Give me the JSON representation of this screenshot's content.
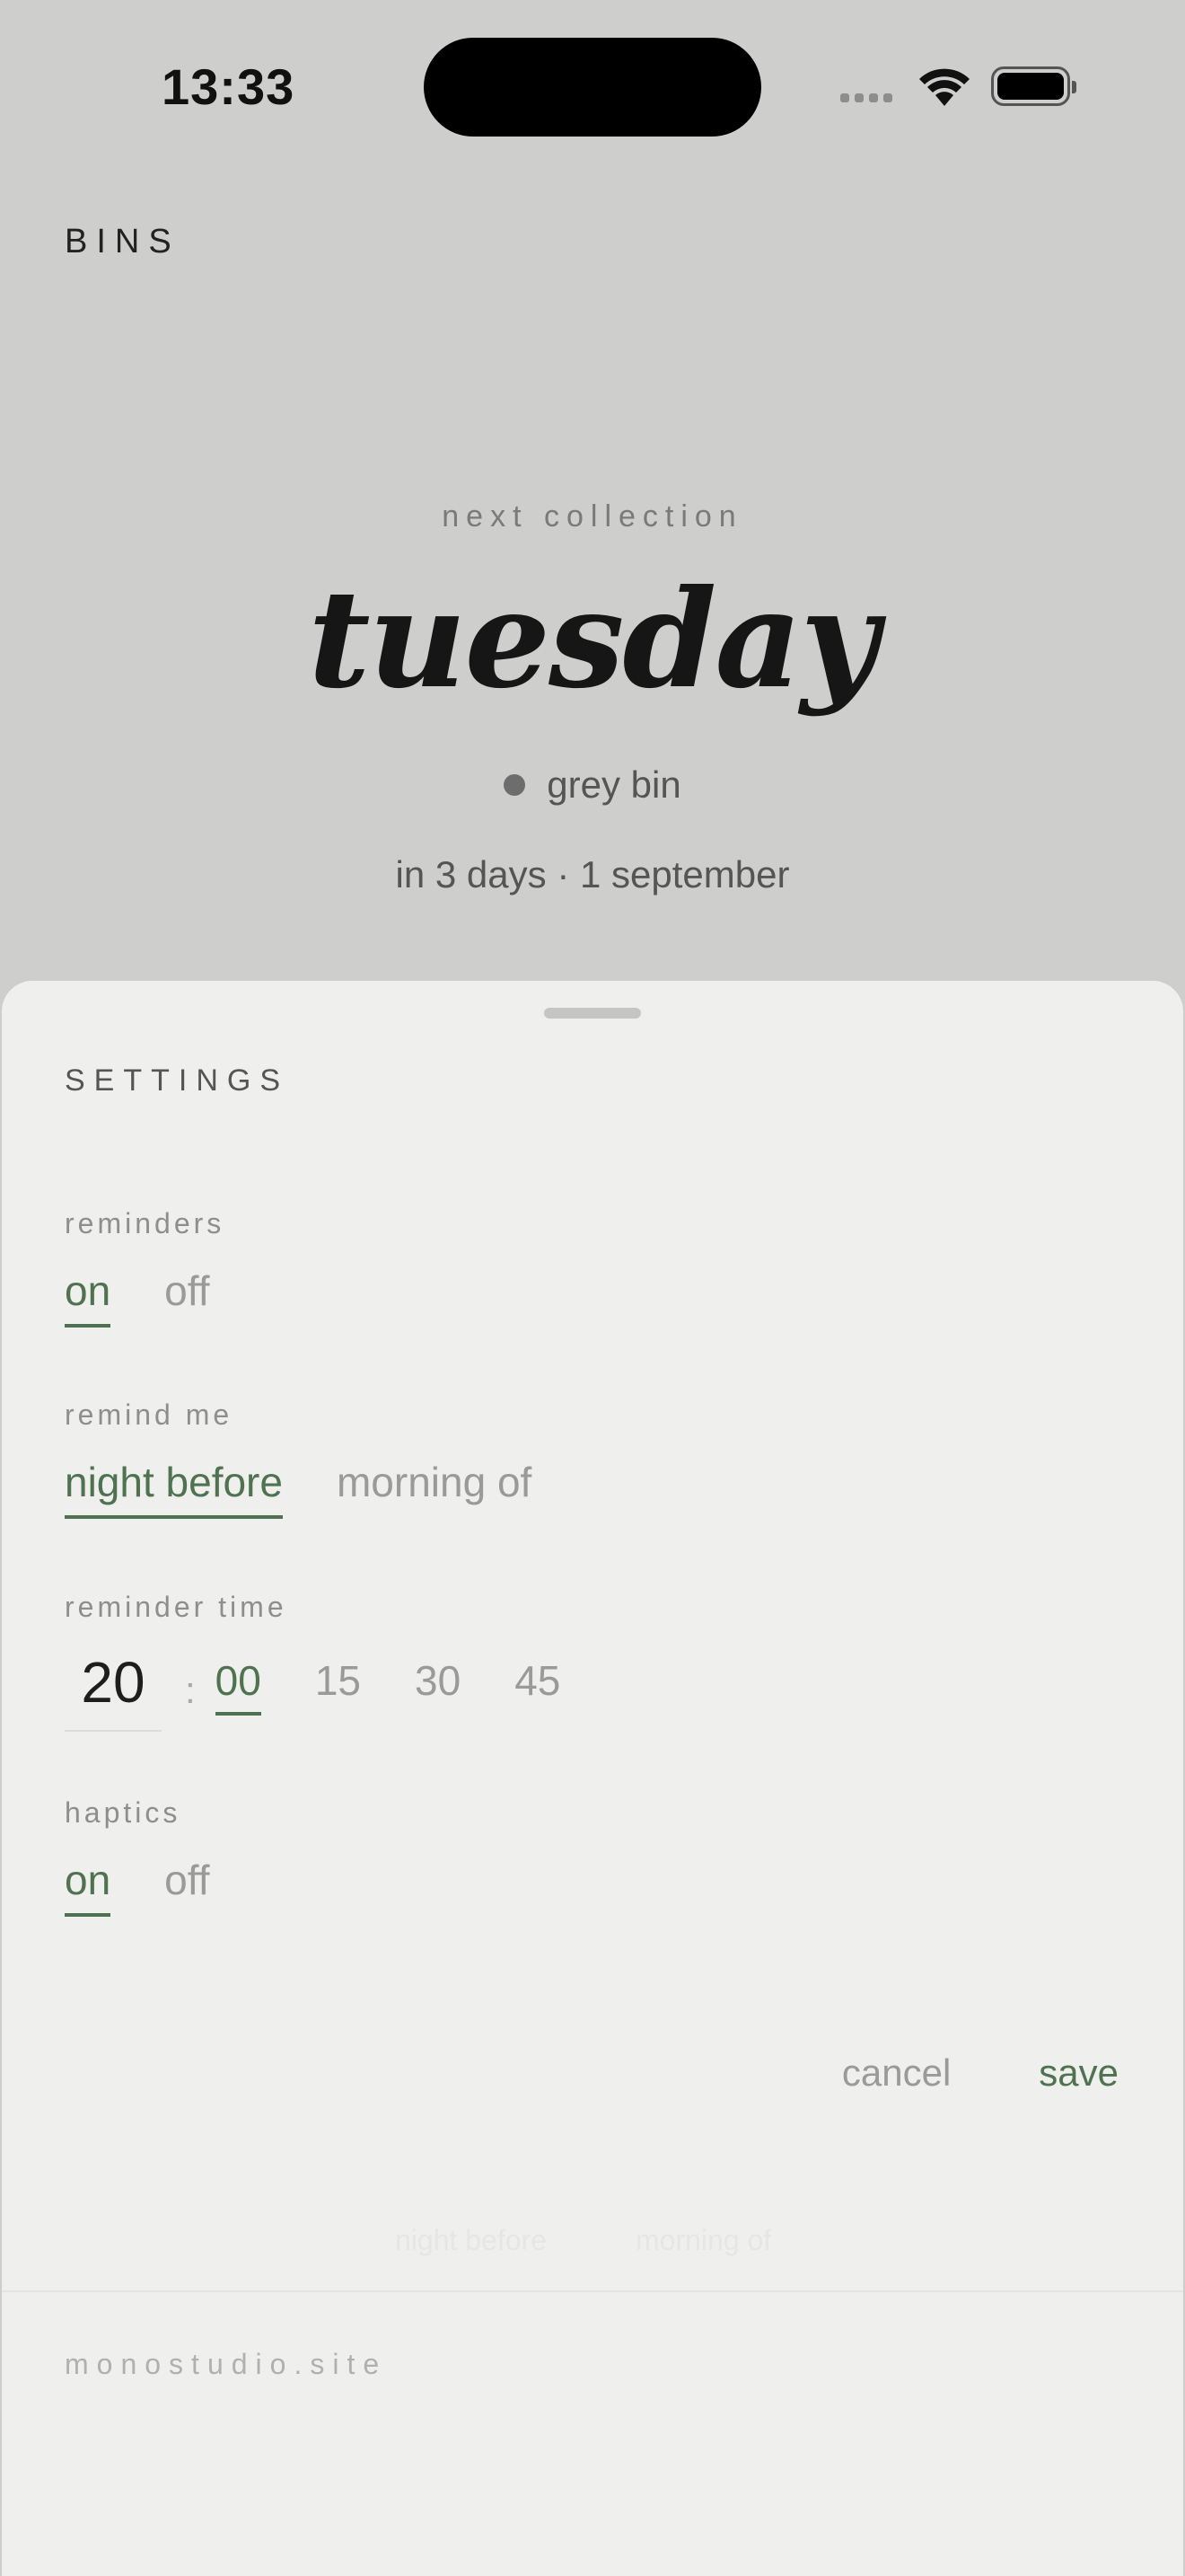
{
  "status_bar": {
    "time": "13:33"
  },
  "app": {
    "title": "BINS"
  },
  "next_collection": {
    "label": "next collection",
    "day": "tuesday",
    "bin_name": "grey bin",
    "bin_color": "#6d6d6d",
    "when": "in 3 days · 1 september"
  },
  "settings": {
    "title": "SETTINGS",
    "reminders": {
      "label": "reminders",
      "options": [
        "on",
        "off"
      ],
      "selected": "on"
    },
    "remind_me": {
      "label": "remind me",
      "options": [
        "night before",
        "morning of"
      ],
      "selected": "night before"
    },
    "reminder_time": {
      "label": "reminder time",
      "hour": "20",
      "separator": ":",
      "minute_options": [
        "00",
        "15",
        "30",
        "45"
      ],
      "selected_minute": "00"
    },
    "haptics": {
      "label": "haptics",
      "options": [
        "on",
        "off"
      ],
      "selected": "on"
    },
    "cancel_label": "cancel",
    "save_label": "save"
  },
  "footer": {
    "site": "monostudio.site"
  },
  "colors": {
    "accent": "#4f7251",
    "background": "#cececc",
    "sheet": "#efefed"
  }
}
